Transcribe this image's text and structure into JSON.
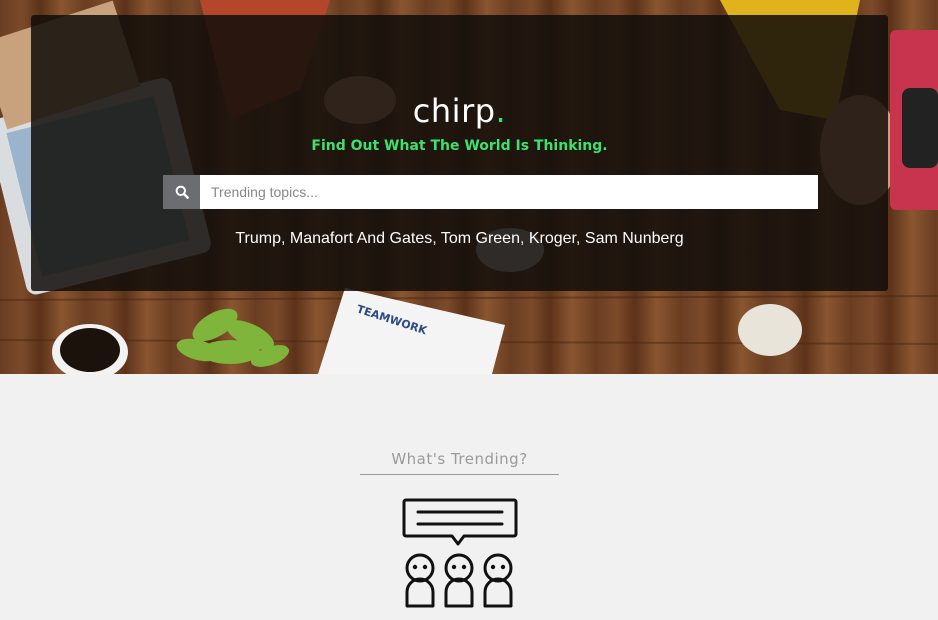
{
  "hero": {
    "logo_text": "chirp",
    "logo_dot": ".",
    "tagline": "Find Out What The World Is Thinking.",
    "accent_color": "#3ce26b"
  },
  "search": {
    "placeholder": "Trending topics...",
    "icon": "search-icon"
  },
  "trending": {
    "topics": [
      "Trump",
      "Manafort And Gates",
      "Tom Green",
      "Kroger",
      "Sam Nunberg"
    ],
    "separator": ", "
  },
  "section": {
    "title": "What's Trending?",
    "icon": "people-chat-icon"
  }
}
